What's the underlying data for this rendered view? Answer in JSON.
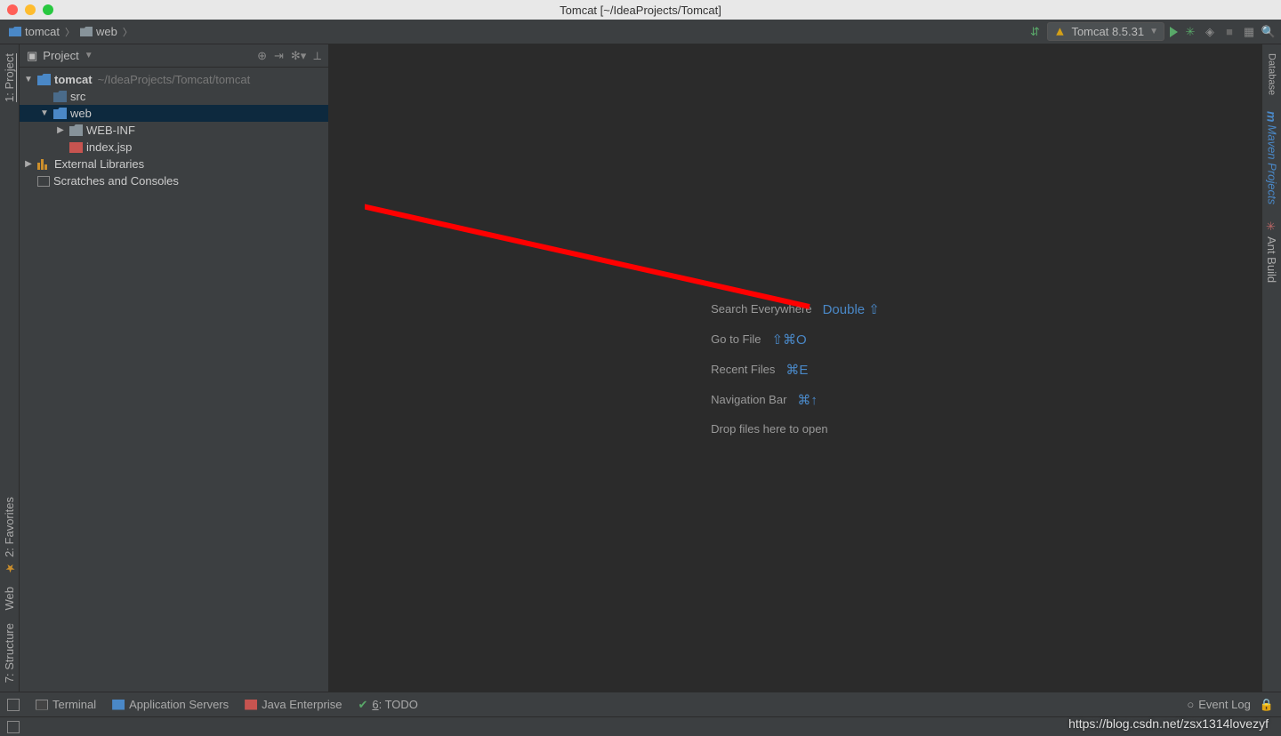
{
  "titlebar": {
    "title": "Tomcat [~/IdeaProjects/Tomcat]"
  },
  "breadcrumb": {
    "items": [
      "tomcat",
      "web"
    ]
  },
  "runConfig": {
    "name": "Tomcat 8.5.31"
  },
  "projectPanel": {
    "title": "Project",
    "tree": {
      "root": {
        "name": "tomcat",
        "path": "~/IdeaProjects/Tomcat/tomcat"
      },
      "src": "src",
      "web": "web",
      "webinf": "WEB-INF",
      "indexjsp": "index.jsp",
      "extLib": "External Libraries",
      "scratches": "Scratches and Consoles"
    }
  },
  "hints": {
    "searchEverywhere": {
      "label": "Search Everywhere",
      "key": "Double ⇧"
    },
    "goToFile": {
      "label": "Go to File",
      "key": "⇧⌘O"
    },
    "recentFiles": {
      "label": "Recent Files",
      "key": "⌘E"
    },
    "navBar": {
      "label": "Navigation Bar",
      "key": "⌘↑"
    },
    "dropFiles": "Drop files here to open"
  },
  "leftGutter": {
    "project": "1: Project",
    "favorites": "2: Favorites",
    "web": "Web",
    "structure": "7: Structure"
  },
  "rightGutter": {
    "database": "Database",
    "maven": "Maven Projects",
    "ant": "Ant Build"
  },
  "statusbar": {
    "terminal": "Terminal",
    "appServers": "Application Servers",
    "javaEE": "Java Enterprise",
    "todo": "6: TODO",
    "eventLog": "Event Log"
  },
  "watermark": "https://blog.csdn.net/zsx1314lovezyf"
}
